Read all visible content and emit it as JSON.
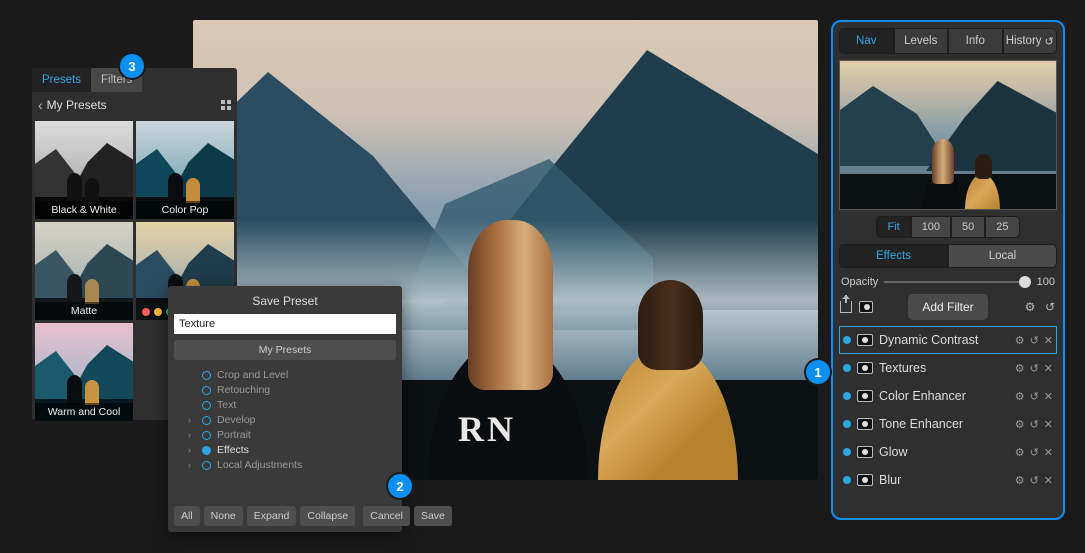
{
  "badges": {
    "b1": "1",
    "b2": "2",
    "b3": "3"
  },
  "canvas": {
    "shirt_text": "RN"
  },
  "right_panel": {
    "tabs": {
      "nav": "Nav",
      "levels": "Levels",
      "info": "Info",
      "history": "History"
    },
    "zoom": {
      "fit": "Fit",
      "z100": "100",
      "z50": "50",
      "z25": "25"
    },
    "mode": {
      "effects": "Effects",
      "local": "Local"
    },
    "opacity": {
      "label": "Opacity",
      "value": "100"
    },
    "add_filter": "Add Filter",
    "filters": [
      {
        "name": "Dynamic Contrast"
      },
      {
        "name": "Textures"
      },
      {
        "name": "Color Enhancer"
      },
      {
        "name": "Tone Enhancer"
      },
      {
        "name": "Glow"
      },
      {
        "name": "Blur"
      }
    ]
  },
  "left_panel": {
    "tabs": {
      "presets": "Presets",
      "filters": "Filters"
    },
    "header": "My Presets",
    "presets": {
      "bw": "Black & White",
      "cp": "Color Pop",
      "matte": "Matte",
      "wc": "Warm and Cool"
    }
  },
  "dialog": {
    "title": "Save Preset",
    "name_value": "Texture ",
    "destination": "My Presets",
    "opts": {
      "crop": "Crop and Level",
      "retouch": "Retouching",
      "text": "Text",
      "develop": "Develop",
      "portrait": "Portrait",
      "effects": "Effects",
      "local": "Local Adjustments"
    },
    "buttons": {
      "all": "All",
      "none": "None",
      "expand": "Expand",
      "collapse": "Collapse",
      "cancel": "Cancel",
      "save": "Save"
    }
  }
}
